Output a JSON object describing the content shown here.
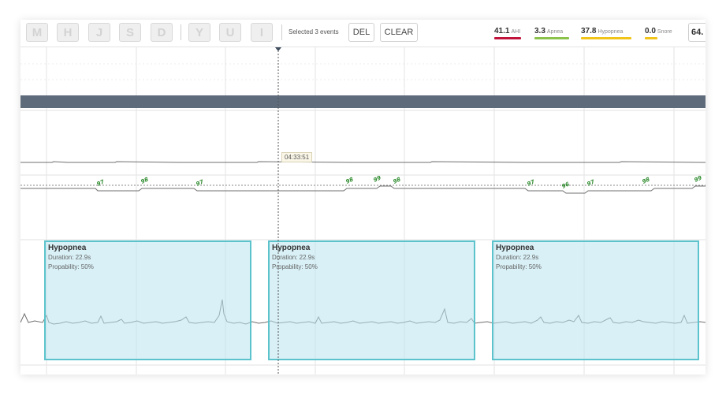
{
  "toolbar": {
    "key_buttons": [
      "M",
      "H",
      "J",
      "S",
      "D",
      "Y",
      "U",
      "I"
    ],
    "selected_text": "Selected 3 events",
    "del_label": "DEL",
    "clear_label": "CLEAR",
    "metrics": [
      {
        "value": "41.1",
        "label": "AHI",
        "color": "#c0143c"
      },
      {
        "value": "3.3",
        "label": "Apnea",
        "color": "#8bc34a"
      },
      {
        "value": "37.8",
        "label": "Hypopnea",
        "color": "#f0c419"
      },
      {
        "value": "0.0",
        "label": "Snore",
        "color": "#f0c419"
      }
    ],
    "metric_cut_value": "64."
  },
  "cursor": {
    "time": "04:33:51"
  },
  "spo2_labels": [
    "97",
    "98",
    "97",
    "98",
    "99",
    "98",
    "97",
    "96",
    "97",
    "98",
    "99"
  ],
  "events": [
    {
      "title": "Hypopnea",
      "duration": "Duration: 22.9s",
      "probability": "Propability: 50%"
    },
    {
      "title": "Hypopnea",
      "duration": "Duration: 22.9s",
      "probability": "Propability: 50%"
    },
    {
      "title": "Hypopnea",
      "duration": "Duration: 22.9s",
      "probability": "Propability: 50%"
    }
  ],
  "colors": {
    "band": "#5d6b7b",
    "event_border": "#5cc3cc",
    "event_fill": "#b8e4ee",
    "spo2_label": "#2e8b2e"
  }
}
